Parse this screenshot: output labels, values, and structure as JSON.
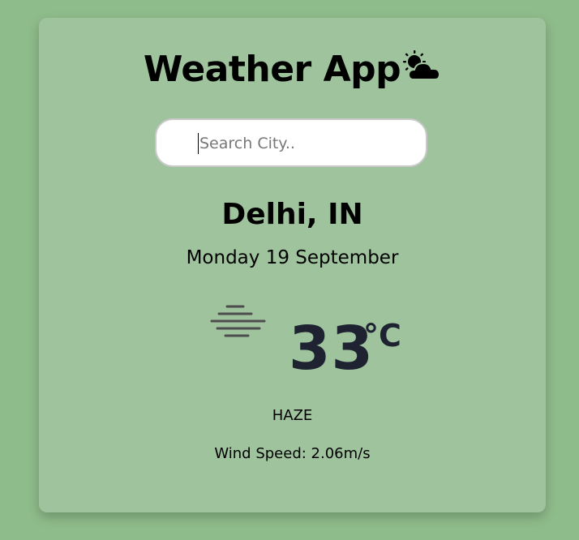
{
  "app": {
    "title": "Weather App",
    "title_icon": "sun-behind-cloud-icon"
  },
  "search": {
    "placeholder": "Search City..",
    "value": ""
  },
  "location": {
    "city": "Delhi, IN",
    "date": "Monday 19 September"
  },
  "weather": {
    "icon": "haze-icon",
    "temperature": "33",
    "unit": "°C",
    "condition": "HAZE",
    "wind_speed": "Wind Speed: 2.06m/s"
  },
  "colors": {
    "page_background": "#8fbc8b",
    "card_background": "#9fc49d",
    "temperature_text": "#1e2231"
  }
}
